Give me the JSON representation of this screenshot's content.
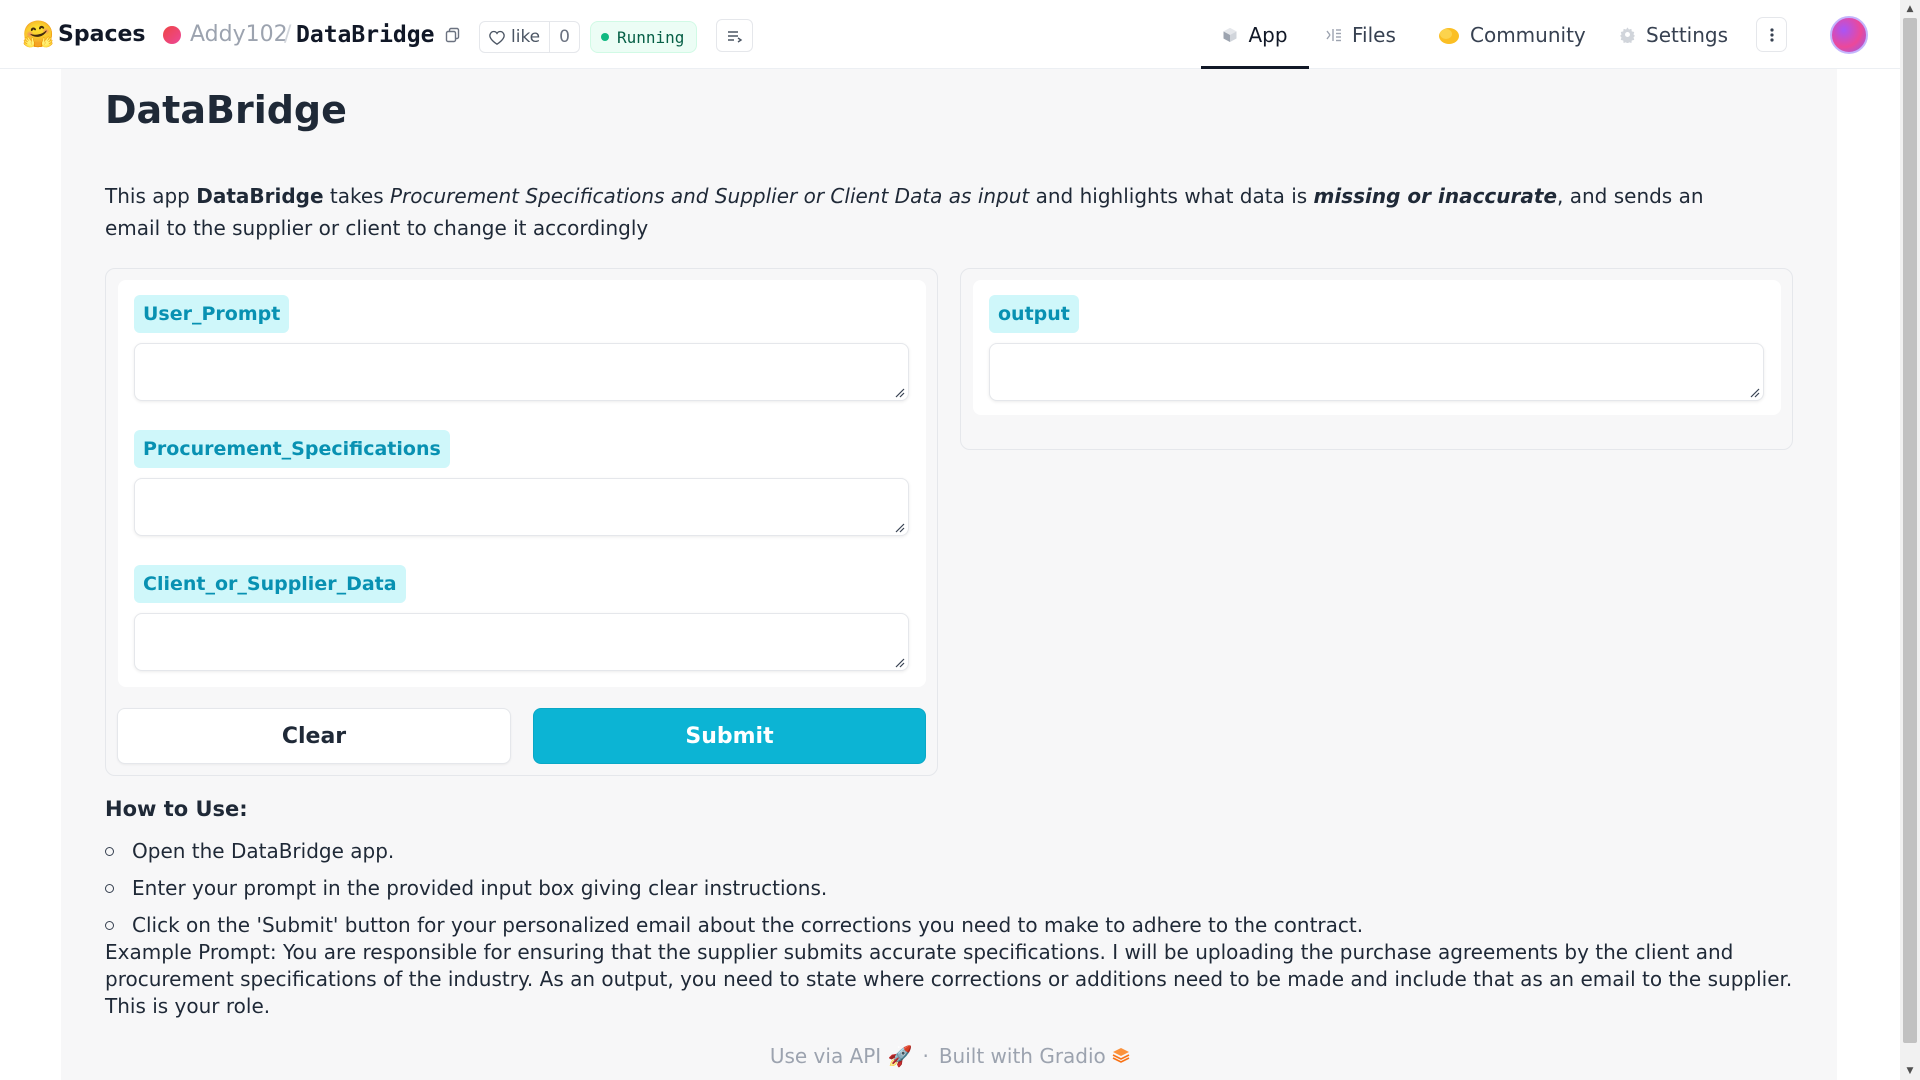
{
  "topbar": {
    "logo_icon": "hugging-face-emoji",
    "spaces_label": "Spaces",
    "owner": "Addy102",
    "separator": "/",
    "repo": "DataBridge",
    "like_label": "like",
    "like_count": "0",
    "status": "Running",
    "status_color": "#10b981",
    "tabs": [
      {
        "label": "App",
        "icon": "cube-icon",
        "active": true
      },
      {
        "label": "Files",
        "icon": "files-icon",
        "active": false
      },
      {
        "label": "Community",
        "icon": "community-icon",
        "active": false
      },
      {
        "label": "Settings",
        "icon": "gear-icon",
        "active": false
      }
    ]
  },
  "app": {
    "title": "DataBridge",
    "description": {
      "p1": "This app ",
      "p2_bold": "DataBridge",
      "p3": " takes ",
      "p4_italic": "Procurement Specifications and Supplier or Client Data as input",
      "p5": " and highlights what data is ",
      "p6_bold_italic": "missing or inaccurate",
      "p7": ", and sends an email to the supplier or client to change it accordingly"
    },
    "inputs": [
      {
        "label": "User_Prompt",
        "value": ""
      },
      {
        "label": "Procurement_Specifications",
        "value": ""
      },
      {
        "label": "Client_or_Supplier_Data",
        "value": ""
      }
    ],
    "output": {
      "label": "output",
      "value": ""
    },
    "buttons": {
      "clear": "Clear",
      "submit": "Submit"
    },
    "accent_color": "#0cb4d4",
    "label_color": "#0891b2"
  },
  "howto": {
    "title": "How to Use:",
    "items": [
      "Open the DataBridge app.",
      "Enter your prompt in the provided input box giving clear instructions.",
      "Click on the 'Submit' button for your personalized email about the corrections you need to make to adhere to the contract."
    ],
    "example": "Example Prompt: You are responsible for ensuring that the supplier submits accurate specifications. I will be uploading the purchase agreements by the client and procurement specifications of the industry. As an output, you need to state where corrections or additions need to be made and include that as an email to the supplier. This is your role."
  },
  "footer": {
    "api_label": "Use via API",
    "separator": "·",
    "built_label": "Built with Gradio"
  }
}
